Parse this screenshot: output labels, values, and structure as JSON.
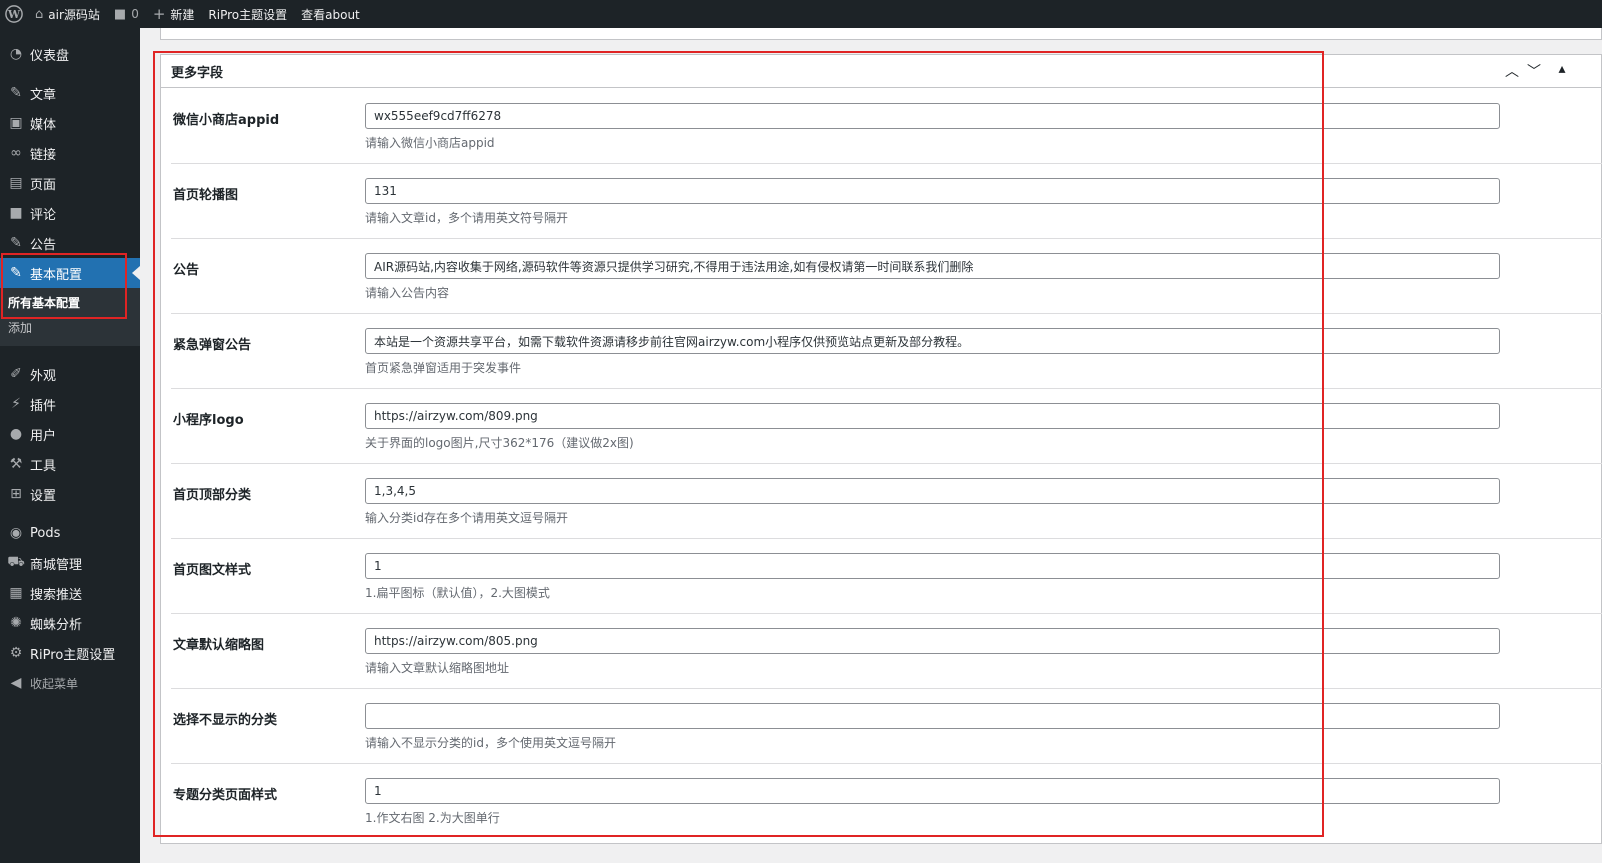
{
  "adminbar": {
    "site_name": "air源码站",
    "comments_count": "0",
    "new_label": "新建",
    "theme_settings": "RiPro主题设置",
    "view_about": "查看about"
  },
  "sidebar": {
    "items": [
      {
        "label": "仪表盘",
        "icon": "dashboard-icon"
      },
      {
        "label": "文章",
        "icon": "pin-icon"
      },
      {
        "label": "媒体",
        "icon": "media-icon"
      },
      {
        "label": "链接",
        "icon": "link-icon"
      },
      {
        "label": "页面",
        "icon": "page-icon"
      },
      {
        "label": "评论",
        "icon": "comment-icon"
      },
      {
        "label": "公告",
        "icon": "pin-icon"
      },
      {
        "label": "基本配置",
        "icon": "pin-icon"
      },
      {
        "label": "外观",
        "icon": "brush-icon"
      },
      {
        "label": "插件",
        "icon": "plugin-icon"
      },
      {
        "label": "用户",
        "icon": "user-icon"
      },
      {
        "label": "工具",
        "icon": "wrench-icon"
      },
      {
        "label": "设置",
        "icon": "settings-icon"
      },
      {
        "label": "Pods",
        "icon": "pods-icon"
      },
      {
        "label": "商城管理",
        "icon": "cart-icon"
      },
      {
        "label": "搜索推送",
        "icon": "search-push-icon"
      },
      {
        "label": "蜘蛛分析",
        "icon": "spider-icon"
      },
      {
        "label": "RiPro主题设置",
        "icon": "gear-icon"
      }
    ],
    "submenu": {
      "current": "所有基本配置",
      "add": "添加"
    },
    "collapse_label": "收起菜单"
  },
  "postbox": {
    "title": "更多字段",
    "fields": [
      {
        "label": "微信小商店appid",
        "value": "wx555eef9cd7ff6278",
        "desc": "请输入微信小商店appid"
      },
      {
        "label": "首页轮播图",
        "value": "131",
        "desc": "请输入文章id，多个请用英文符号隔开"
      },
      {
        "label": "公告",
        "value": "AIR源码站,内容收集于网络,源码软件等资源只提供学习研究,不得用于违法用途,如有侵权请第一时间联系我们删除",
        "desc": "请输入公告内容"
      },
      {
        "label": "紧急弹窗公告",
        "value": "本站是一个资源共享平台，如需下载软件资源请移步前往官网airzyw.com小程序仅供预览站点更新及部分教程。",
        "desc": "首页紧急弹窗适用于突发事件"
      },
      {
        "label": "小程序logo",
        "value": "https://airzyw.com/809.png",
        "desc": "关于界面的logo图片,尺寸362*176（建议做2x图)"
      },
      {
        "label": "首页顶部分类",
        "value": "1,3,4,5",
        "desc": "输入分类id存在多个请用英文逗号隔开"
      },
      {
        "label": "首页图文样式",
        "value": "1",
        "desc": "1.扁平图标（默认值），2.大图模式"
      },
      {
        "label": "文章默认缩略图",
        "value": "https://airzyw.com/805.png",
        "desc": "请输入文章默认缩略图地址"
      },
      {
        "label": "选择不显示的分类",
        "value": "",
        "desc": "请输入不显示分类的id，多个使用英文逗号隔开"
      },
      {
        "label": "专题分类页面样式",
        "value": "1",
        "desc": "1.作文右图 2.为大图单行"
      }
    ]
  },
  "colors": {
    "admin_dark": "#1d2327",
    "active_blue": "#2271b1",
    "highlight_red": "#e02424"
  }
}
